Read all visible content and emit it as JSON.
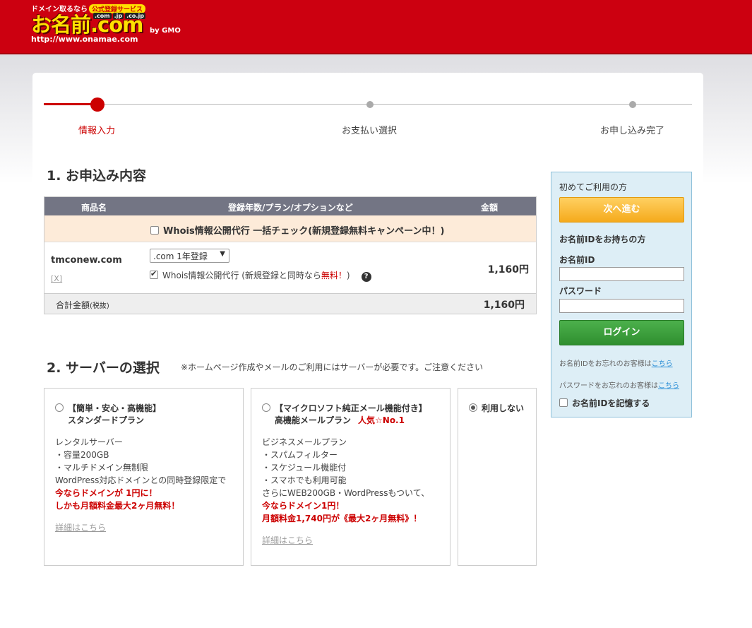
{
  "header": {
    "tagline": "ドメイン取るなら",
    "badge": "公式登録サービス",
    "tlds": [
      ".com",
      ".jp",
      ".co.jp"
    ],
    "wordmark": "お名前.com",
    "by": "by GMO",
    "url": "http://www.onamae.com"
  },
  "progress": {
    "steps": [
      "情報入力",
      "お支払い選択",
      "お申し込み完了"
    ],
    "current_step": 1
  },
  "section1": {
    "title": "1. お申込み内容",
    "columns": [
      "商品名",
      "登録年数/プラン/オプションなど",
      "金額"
    ],
    "campaign_text": "Whois情報公開代行 一括チェック(新規登録無料キャンペーン中！)",
    "item": {
      "domain": "tmconew.com",
      "remove": "[X]",
      "plan_selected": ".com 1年登録",
      "whois_text": "Whois情報公開代行 (新規登録と同時なら",
      "whois_free": "無料！",
      "whois_close": ")",
      "help": "?",
      "price": "1,160円"
    },
    "total_label": "合計金額",
    "total_tax": "(税抜)",
    "total_value": "1,160円"
  },
  "section2": {
    "title": "2. サーバーの選択",
    "note": "※ホームページ作成やメールのご利用にはサーバーが必要です。ご注意ください",
    "plans": [
      {
        "title1": "【簡単・安心・高機能】",
        "title2": "スタンダードプラン",
        "lines": [
          "レンタルサーバー",
          "・容量200GB",
          "・マルチドメイン無制限",
          "WordPress対応ドメインとの同時登録限定で"
        ],
        "red_lines": [
          "今ならドメインが 1円に！",
          "しかも月額料金最大2ヶ月無料！"
        ],
        "detail": "詳細はこちら",
        "selected": false
      },
      {
        "title1": "【マイクロソフト純正メール機能付き】",
        "title2": "高機能メールプラン",
        "hot": "人気☆No.1",
        "lines": [
          "ビジネスメールプラン",
          "・スパムフィルター",
          "・スケジュール機能付",
          "・スマホでも利用可能",
          "さらにWEB200GB・WordPressもついて、"
        ],
        "red_lines": [
          "今ならドメイン1円！",
          "月額料金1,740円が《最大2ヶ月無料》！"
        ],
        "detail": "詳細はこちら",
        "selected": false
      },
      {
        "title1": "利用しない",
        "selected": true
      }
    ]
  },
  "sidebar": {
    "first_time": "初めてご利用の方",
    "next_button": "次へ進む",
    "have_id": "お名前IDをお持ちの方",
    "id_label": "お名前ID",
    "pw_label": "パスワード",
    "login_button": "ログイン",
    "forgot_id_text": "お名前IDをお忘れのお客様は",
    "forgot_id_link": "こちら",
    "forgot_pw_text": "パスワードをお忘れのお客様は",
    "forgot_pw_link": "こちら",
    "remember": "お名前IDを記憶する"
  },
  "colors": {
    "brand_red": "#cc0010",
    "next_orange": "#f5aa1c",
    "login_green": "#2f8f2f",
    "table_header": "#737584"
  }
}
